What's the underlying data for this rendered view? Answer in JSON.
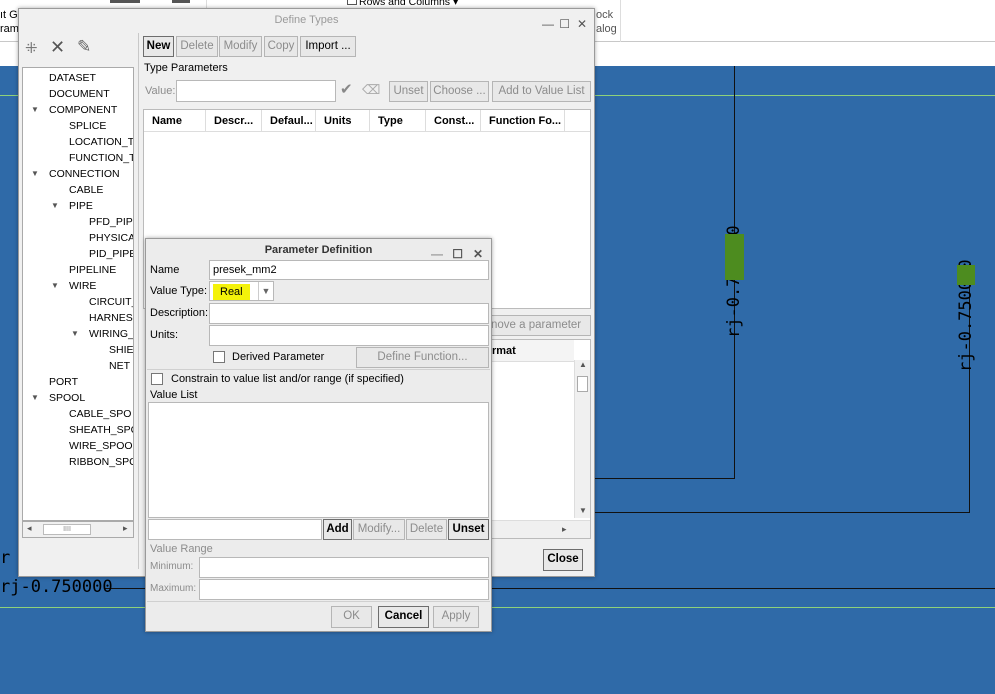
{
  "ribbon": {
    "left_text_1": "ıt G",
    "left_text_2": "ram",
    "rows_columns": "Rows and Columns",
    "right_text_1": "ock",
    "right_text_2": "alog"
  },
  "canvas": {
    "label_left": "rj-0.750000",
    "label_left_prefix": "r",
    "label_v1": "rj-0.750000",
    "label_v2": "rj-0.750000"
  },
  "define_types": {
    "title": "Define Types",
    "toolbar": {
      "new": "New",
      "delete": "Delete",
      "modify": "Modify",
      "copy": "Copy",
      "import": "Import ..."
    },
    "type_parameters_label": "Type Parameters",
    "value_label": "Value:",
    "value_input": "",
    "unset": "Unset",
    "choose": "Choose ...",
    "add_to_value_list": "Add to Value List",
    "columns": [
      "Name",
      "Descr...",
      "Defaul...",
      "Units",
      "Type",
      "Const...",
      "Function Fo..."
    ],
    "remove_parameter": "nove a parameter",
    "format_header": "rmat",
    "close": "Close",
    "tree": [
      {
        "label": "DATASET",
        "level": 0,
        "expand": false
      },
      {
        "label": "DOCUMENT",
        "level": 0,
        "expand": false
      },
      {
        "label": "COMPONENT",
        "level": 0,
        "expand": true
      },
      {
        "label": "SPLICE",
        "level": 1,
        "expand": false
      },
      {
        "label": "LOCATION_T",
        "level": 1,
        "expand": false
      },
      {
        "label": "FUNCTION_T",
        "level": 1,
        "expand": false
      },
      {
        "label": "CONNECTION",
        "level": 0,
        "expand": true
      },
      {
        "label": "CABLE",
        "level": 1,
        "expand": false
      },
      {
        "label": "PIPE",
        "level": 1,
        "expand": true
      },
      {
        "label": "PFD_PIPE",
        "level": 2,
        "expand": false
      },
      {
        "label": "PHYSICA",
        "level": 2,
        "expand": false
      },
      {
        "label": "PID_PIPE",
        "level": 2,
        "expand": false
      },
      {
        "label": "PIPELINE",
        "level": 1,
        "expand": false
      },
      {
        "label": "WIRE",
        "level": 1,
        "expand": true
      },
      {
        "label": "CIRCUIT_",
        "level": 2,
        "expand": false
      },
      {
        "label": "HARNES",
        "level": 2,
        "expand": false
      },
      {
        "label": "WIRING_",
        "level": 2,
        "expand": true
      },
      {
        "label": "SHIE",
        "level": 3,
        "expand": false
      },
      {
        "label": "NET",
        "level": 3,
        "expand": false
      },
      {
        "label": "PORT",
        "level": 0,
        "expand": false
      },
      {
        "label": "SPOOL",
        "level": 0,
        "expand": true
      },
      {
        "label": "CABLE_SPO",
        "level": 1,
        "expand": false
      },
      {
        "label": "SHEATH_SPC",
        "level": 1,
        "expand": false
      },
      {
        "label": "WIRE_SPOOL",
        "level": 1,
        "expand": false
      },
      {
        "label": "RIBBON_SPC",
        "level": 1,
        "expand": false
      }
    ],
    "scroll_grip": "IIII"
  },
  "param_def": {
    "title": "Parameter Definition",
    "name_label": "Name",
    "name_value": "presek_mm2",
    "value_type_label": "Value Type:",
    "value_type_value": "Real",
    "description_label": "Description:",
    "description_value": "",
    "units_label": "Units:",
    "units_value": "",
    "derived_parameter": "Derived Parameter",
    "define_function": "Define Function...",
    "constrain_label": "Constrain to value list and/or range (if specified)",
    "value_list_label": "Value List",
    "add": "Add",
    "modify": "Modify...",
    "delete": "Delete",
    "unset": "Unset",
    "value_range_label": "Value Range",
    "minimum_label": "Minimum:",
    "maximum_label": "Maximum:",
    "ok": "OK",
    "cancel": "Cancel",
    "apply": "Apply",
    "highlight_color": "#f4f20a"
  }
}
